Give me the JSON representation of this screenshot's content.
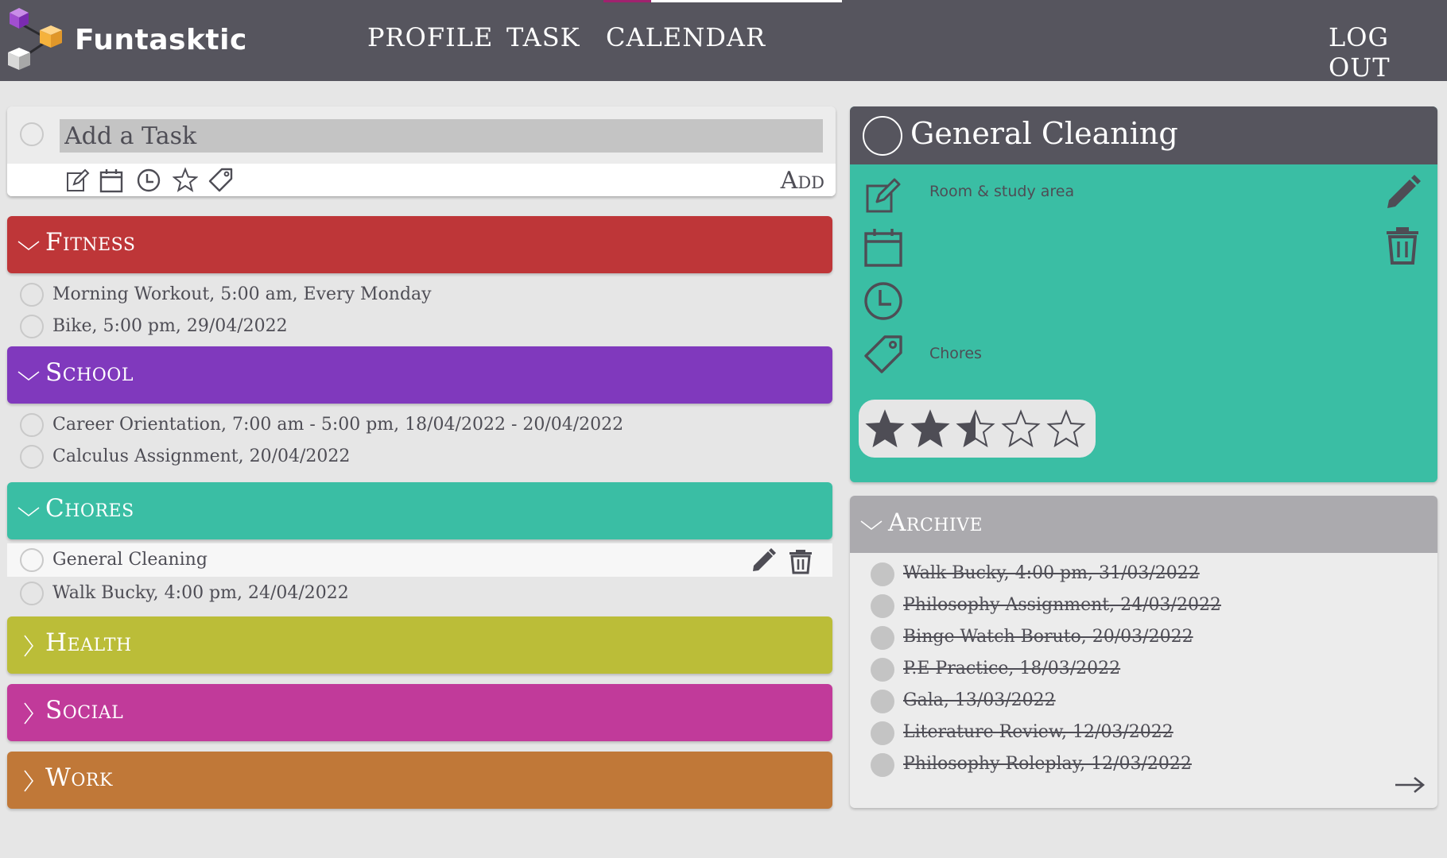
{
  "app": {
    "name": "Funtasktic"
  },
  "nav": {
    "profile": "PROFILE",
    "task": "TASK",
    "calendar": "CALENDAR",
    "logout": "LOG OUT"
  },
  "add_task": {
    "placeholder": "Add a Task",
    "add_label": "Add"
  },
  "categories": [
    {
      "label": "Fitness",
      "color": "#be3638",
      "expanded": true,
      "tasks": [
        "Morning Workout, 5:00 am, Every Monday",
        "Bike, 5:00 pm, 29/04/2022"
      ]
    },
    {
      "label": "School",
      "color": "#8039bd",
      "expanded": true,
      "tasks": [
        "Career Orientation, 7:00 am - 5:00 pm, 18/04/2022 - 20/04/2022",
        "Calculus Assignment, 20/04/2022"
      ]
    },
    {
      "label": "Chores",
      "color": "#3abea4",
      "expanded": true,
      "tasks": [
        "General Cleaning",
        "Walk Bucky, 4:00 pm, 24/04/2022"
      ]
    },
    {
      "label": "Health",
      "color": "#bbbd38",
      "expanded": false,
      "tasks": []
    },
    {
      "label": "Social",
      "color": "#c13a9a",
      "expanded": false,
      "tasks": []
    },
    {
      "label": "Work",
      "color": "#c07838",
      "expanded": false,
      "tasks": []
    }
  ],
  "detail": {
    "title": "General Cleaning",
    "note": "Room & study area",
    "tag": "Chores",
    "rating": 2.5,
    "rating_max": 5
  },
  "archive": {
    "label": "Archive",
    "items": [
      "Walk Bucky, 4:00 pm, 31/03/2022",
      "Philosophy Assignment, 24/03/2022",
      "Binge Watch Boruto, 20/03/2022",
      "P.E Practice, 18/03/2022",
      "Gala, 13/03/2022",
      "Literature Review, 12/03/2022",
      "Philosophy Roleplay, 12/03/2022"
    ]
  },
  "colors": {
    "header": "#56555e",
    "accent_nav": "#a0226e",
    "text": "#4e4d55"
  },
  "icons": [
    "edit-icon",
    "calendar-icon",
    "clock-icon",
    "star-icon",
    "tag-icon",
    "pencil-icon",
    "trash-icon",
    "chevron-down-icon",
    "chevron-right-icon",
    "arrow-right-icon"
  ]
}
